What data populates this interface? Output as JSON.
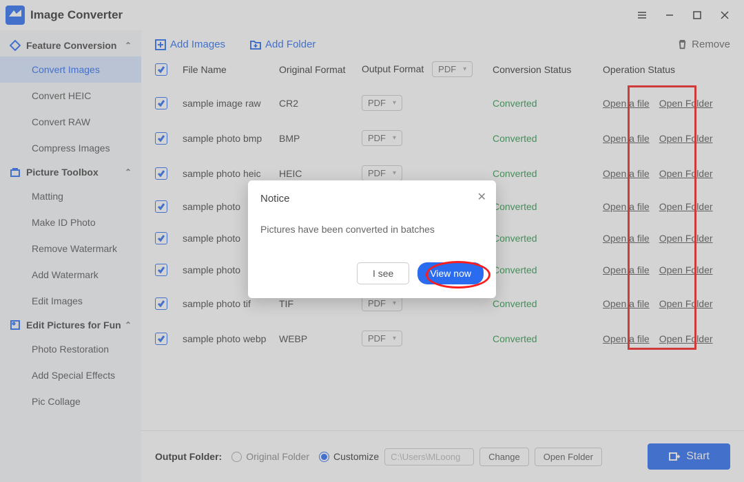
{
  "app": {
    "title": "Image Converter"
  },
  "sidebar": {
    "sections": [
      {
        "label": "Feature Conversion",
        "items": [
          "Convert Images",
          "Convert HEIC",
          "Convert RAW",
          "Compress Images"
        ],
        "active_index": 0
      },
      {
        "label": "Picture Toolbox",
        "items": [
          "Matting",
          "Make ID Photo",
          "Remove Watermark",
          "Add Watermark",
          "Edit Images"
        ]
      },
      {
        "label": "Edit Pictures for Fun",
        "items": [
          "Photo Restoration",
          "Add Special Effects",
          "Pic Collage"
        ]
      }
    ]
  },
  "toolbar": {
    "add_images": "Add Images",
    "add_folder": "Add Folder",
    "remove": "Remove"
  },
  "table": {
    "headers": {
      "name": "File Name",
      "orig": "Original Format",
      "out": "Output Format",
      "status": "Conversion Status",
      "ops": "Operation Status"
    },
    "global_out": "PDF",
    "rows": [
      {
        "name": "sample image raw",
        "orig": "CR2",
        "out": "PDF",
        "status": "Converted"
      },
      {
        "name": "sample photo bmp",
        "orig": "BMP",
        "out": "PDF",
        "status": "Converted"
      },
      {
        "name": "sample photo heic",
        "orig": "HEIC",
        "out": "PDF",
        "status": "Converted"
      },
      {
        "name": "sample photo",
        "orig": "",
        "out": "",
        "status": "Converted"
      },
      {
        "name": "sample photo",
        "orig": "",
        "out": "",
        "status": "Converted"
      },
      {
        "name": "sample photo",
        "orig": "",
        "out": "",
        "status": "Converted"
      },
      {
        "name": "sample photo tif",
        "orig": "TIF",
        "out": "PDF",
        "status": "Converted"
      },
      {
        "name": "sample photo webp",
        "orig": "WEBP",
        "out": "PDF",
        "status": "Converted"
      }
    ],
    "op_open_file": "Open a file",
    "op_open_folder": "Open Folder"
  },
  "footer": {
    "label": "Output Folder:",
    "opt_original": "Original Folder",
    "opt_custom": "Customize",
    "path": "C:\\Users\\MLoong",
    "change": "Change",
    "open_folder": "Open Folder",
    "start": "Start"
  },
  "modal": {
    "title": "Notice",
    "body": "Pictures have been converted in batches",
    "btn_secondary": "I see",
    "btn_primary": "View now"
  }
}
